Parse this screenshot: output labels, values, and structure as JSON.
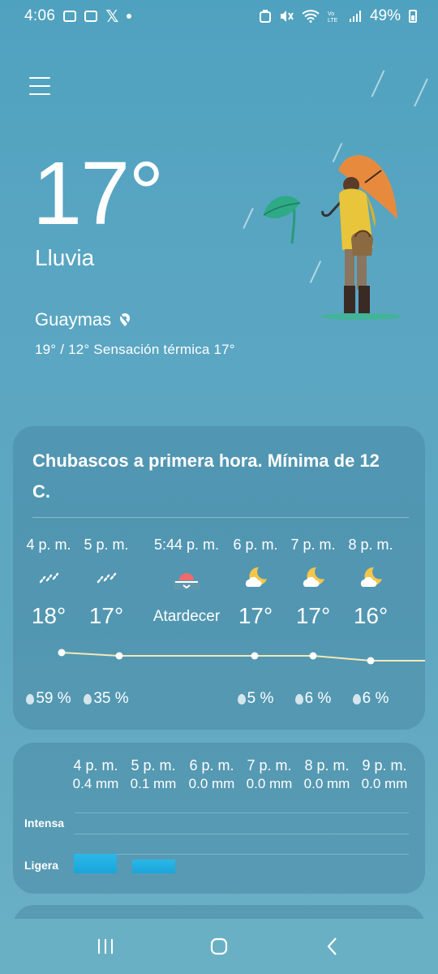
{
  "status": {
    "time": "4:06",
    "battery": "49%"
  },
  "current": {
    "temperature": "17°",
    "condition": "Lluvia",
    "location": "Guaymas",
    "minmax_feels": "19° / 12° Sensación térmica 17°"
  },
  "hourly": {
    "summary": "Chubascos a primera hora. Mínima de 12 C.",
    "items": [
      {
        "time": "4 p. m.",
        "icon": "rain-icon",
        "temp": "18°",
        "precip": "59 %"
      },
      {
        "time": "5 p. m.",
        "icon": "rain-icon",
        "temp": "17°",
        "precip": "35 %"
      },
      {
        "time": "5:44 p. m.",
        "icon": "sunset-icon",
        "temp": "Atardecer",
        "precip": ""
      },
      {
        "time": "6 p. m.",
        "icon": "moon-cloud-icon",
        "temp": "17°",
        "precip": "5 %"
      },
      {
        "time": "7 p. m.",
        "icon": "moon-cloud-icon",
        "temp": "17°",
        "precip": "6 %"
      },
      {
        "time": "8 p. m.",
        "icon": "moon-cloud-icon",
        "temp": "16°",
        "precip": "6 %"
      }
    ]
  },
  "precipitation": {
    "items": [
      {
        "time": "4 p. m.",
        "amount": "0.4 mm"
      },
      {
        "time": "5 p. m.",
        "amount": "0.1 mm"
      },
      {
        "time": "6 p. m.",
        "amount": "0.0 mm"
      },
      {
        "time": "7 p. m.",
        "amount": "0.0 mm"
      },
      {
        "time": "8 p. m.",
        "amount": "0.0 mm"
      },
      {
        "time": "9 p. m.",
        "amount": "0.0 mm"
      }
    ],
    "label_heavy": "Intensa",
    "label_light": "Ligera"
  },
  "colors": {
    "umbrella": "#e88a3e",
    "raincoat": "#e8c53a",
    "leaf": "#2eaa86",
    "bar": "#22b0e2"
  }
}
